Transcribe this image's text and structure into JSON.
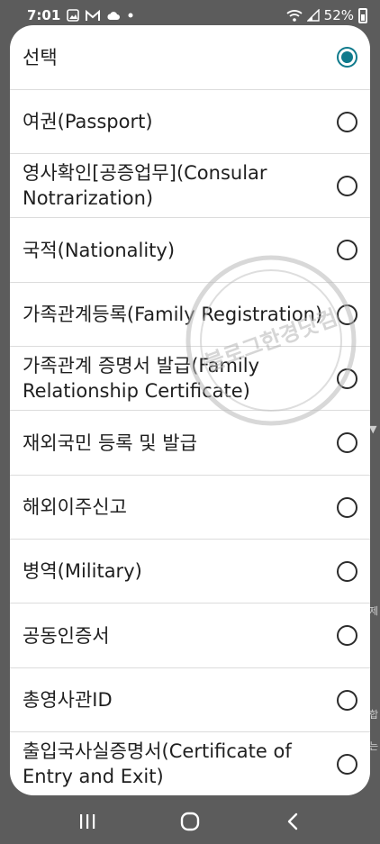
{
  "status_bar": {
    "time": "7:01",
    "battery": "52%",
    "icons": [
      "gallery-icon",
      "mail-icon",
      "cloud-icon",
      "dot-icon",
      "wifi-icon",
      "signal-icon",
      "battery-icon"
    ]
  },
  "dialog": {
    "options": [
      {
        "label": "선택",
        "selected": true
      },
      {
        "label": "여권(Passport)",
        "selected": false
      },
      {
        "label": "영사확인[공증업무](Consular Notrarization)",
        "selected": false
      },
      {
        "label": "국적(Nationality)",
        "selected": false
      },
      {
        "label": "가족관계등록(Family Registration)",
        "selected": false
      },
      {
        "label": "가족관계 증명서 발급(Family Relationship Certificate)",
        "selected": false
      },
      {
        "label": "재외국민 등록 및 발급",
        "selected": false
      },
      {
        "label": "해외이주신고",
        "selected": false
      },
      {
        "label": "병역(Military)",
        "selected": false
      },
      {
        "label": "공동인증서",
        "selected": false
      },
      {
        "label": "총영사관ID",
        "selected": false
      },
      {
        "label": "출입국사실증명서(Certificate of Entry and Exit)",
        "selected": false
      }
    ],
    "accent_color": "#0f7a8c"
  },
  "watermark": {
    "text": "블로그한경닷컴"
  },
  "nav_bar": {
    "buttons": [
      "recent-apps-icon",
      "home-icon",
      "back-icon"
    ]
  }
}
